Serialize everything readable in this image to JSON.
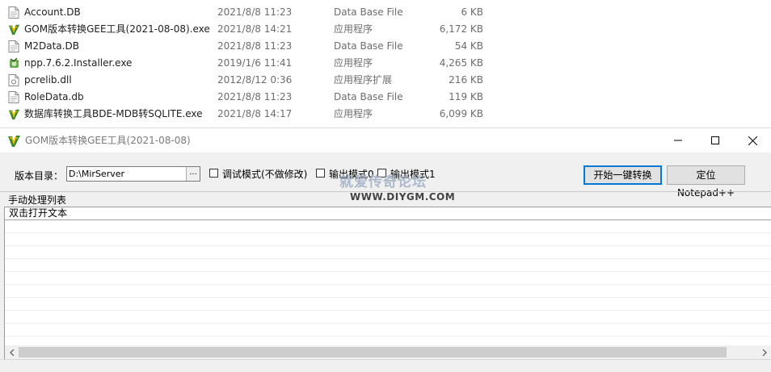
{
  "files": [
    {
      "name": "Account.DB",
      "date": "2021/8/8 11:23",
      "type": "Data Base File",
      "size": "6 KB",
      "icon": "db-file-icon"
    },
    {
      "name": "GOM版本转换GEE工具(2021-08-08).exe",
      "date": "2021/8/8 14:21",
      "type": "应用程序",
      "size": "6,172 KB",
      "icon": "app-exe-icon"
    },
    {
      "name": "M2Data.DB",
      "date": "2021/8/8 11:23",
      "type": "Data Base File",
      "size": "54 KB",
      "icon": "db-file-icon"
    },
    {
      "name": "npp.7.6.2.Installer.exe",
      "date": "2019/1/6 11:41",
      "type": "应用程序",
      "size": "4,265 KB",
      "icon": "installer-icon"
    },
    {
      "name": "pcrelib.dll",
      "date": "2012/8/12 0:36",
      "type": "应用程序扩展",
      "size": "216 KB",
      "icon": "dll-file-icon"
    },
    {
      "name": "RoleData.db",
      "date": "2021/8/8 11:23",
      "type": "Data Base File",
      "size": "119 KB",
      "icon": "db-file-icon"
    },
    {
      "name": "数据库转换工具BDE-MDB转SQLITE.exe",
      "date": "2021/8/8 14:17",
      "type": "应用程序",
      "size": "6,099 KB",
      "icon": "app-exe-icon"
    }
  ],
  "window": {
    "title": "GOM版本转换GEE工具(2021-08-08)",
    "dir_label": "版本目录：",
    "dir_value": "D:\\MirServer",
    "browse_label": "...",
    "check_debug": "调试模式(不做修改)",
    "check_mode0": "输出模式0",
    "check_mode1": "输出模式1",
    "start_button": "开始一键转换",
    "notepad_button": "定位Notepad++",
    "manual_label": "手动处理列表",
    "list_header": "双击打开文本"
  },
  "watermark": {
    "cn": "就爱传奇论坛",
    "en": "WWW.DIYGM.COM"
  }
}
